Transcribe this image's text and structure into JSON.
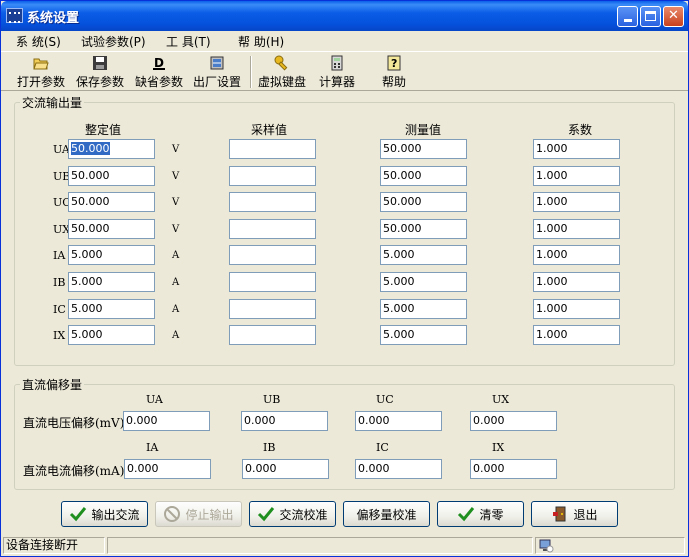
{
  "window": {
    "title": "系统设置"
  },
  "menu": [
    "系 统(S)",
    "试验参数(P)",
    "工 具(T)",
    "帮 助(H)"
  ],
  "toolbar": [
    "打开参数",
    "保存参数",
    "缺省参数",
    "出厂设置",
    "虚拟键盘",
    "计算器",
    "帮助"
  ],
  "ac": {
    "title": "交流输出量",
    "headers": [
      "整定值",
      "采样值",
      "测量值",
      "系数"
    ],
    "rows": [
      {
        "label": "UA",
        "unit": "V",
        "set": "50.000",
        "sample": "",
        "measure": "50.000",
        "coef": "1.000"
      },
      {
        "label": "UB",
        "unit": "V",
        "set": "50.000",
        "sample": "",
        "measure": "50.000",
        "coef": "1.000"
      },
      {
        "label": "UC",
        "unit": "V",
        "set": "50.000",
        "sample": "",
        "measure": "50.000",
        "coef": "1.000"
      },
      {
        "label": "UX",
        "unit": "V",
        "set": "50.000",
        "sample": "",
        "measure": "50.000",
        "coef": "1.000"
      },
      {
        "label": "IA",
        "unit": "A",
        "set": "5.000",
        "sample": "",
        "measure": "5.000",
        "coef": "1.000"
      },
      {
        "label": "IB",
        "unit": "A",
        "set": "5.000",
        "sample": "",
        "measure": "5.000",
        "coef": "1.000"
      },
      {
        "label": "IC",
        "unit": "A",
        "set": "5.000",
        "sample": "",
        "measure": "5.000",
        "coef": "1.000"
      },
      {
        "label": "IX",
        "unit": "A",
        "set": "5.000",
        "sample": "",
        "measure": "5.000",
        "coef": "1.000"
      }
    ]
  },
  "dc": {
    "title": "直流偏移量",
    "voltage_label": "直流电压偏移(mV)",
    "current_label": "直流电流偏移(mA)",
    "voltage_headers": [
      "UA",
      "UB",
      "UC",
      "UX"
    ],
    "current_headers": [
      "IA",
      "IB",
      "IC",
      "IX"
    ],
    "voltage_values": [
      "0.000",
      "0.000",
      "0.000",
      "0.000"
    ],
    "current_values": [
      "0.000",
      "0.000",
      "0.000",
      "0.000"
    ]
  },
  "buttons": {
    "ac_output": "输出交流",
    "stop_output": "停止输出",
    "ac_calibrate": "交流校准",
    "offset_calibrate": "偏移量校准",
    "zero": "清零",
    "exit": "退出"
  },
  "status": {
    "text": "设备连接断开"
  }
}
